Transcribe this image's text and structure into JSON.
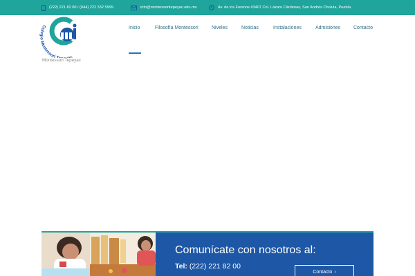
{
  "topbar": {
    "phone": "(222) 221 82 00 / (044) 222 332 5999",
    "email": "info@montessoritepeyac.edu.mx",
    "address": "Av. de los Fresnos #3407 Col. Lázaro Cárdenas, San Andrés Cholula, Puebla.",
    "background": "#1fa59b"
  },
  "logo": {
    "arc_text": "Colegio Montessori Tepeyac",
    "caption": "Montessori Tepeyac"
  },
  "nav": {
    "items": [
      "Inicio",
      "Filosofía Montessori",
      "Niveles",
      "Noticias",
      "Instalaciones",
      "Admisiones",
      "Contacto"
    ],
    "active": "Inicio"
  },
  "banner": {
    "title": "Comunícate con nosotros al:",
    "tel_label": "Tel:",
    "tel_number": "(222) 221 82 00",
    "button_label": "Contacto",
    "button_arrow": "›",
    "background": "#1d57a6"
  }
}
